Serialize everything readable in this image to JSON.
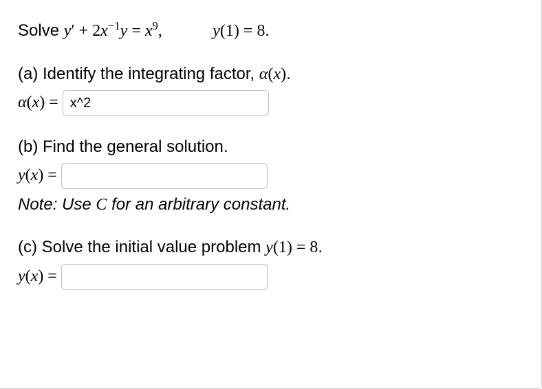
{
  "problem": {
    "prefix": "Solve ",
    "equation_html": "y′ + 2x<sup>−1</sup>y = x<sup>9</sup>,",
    "initial_condition_html": "y(1) = 8."
  },
  "part_a": {
    "prompt_html": "(a) Identify the integrating factor, <span class=\"math\">α(x)</span>.",
    "lhs_html": "α(x) = ",
    "value": "x^2"
  },
  "part_b": {
    "prompt": "(b) Find the general solution.",
    "lhs_html": "y(x) = ",
    "value": "",
    "note_html": "Note: Use <span class=\"math\">C</span> for an arbitrary constant."
  },
  "part_c": {
    "prompt_html": "(c) Solve the initial value problem <span class=\"math\">y(<span class=\"upright\">1</span>) = <span class=\"upright\">8</span></span>.",
    "lhs_html": "y(x) = ",
    "value": ""
  }
}
